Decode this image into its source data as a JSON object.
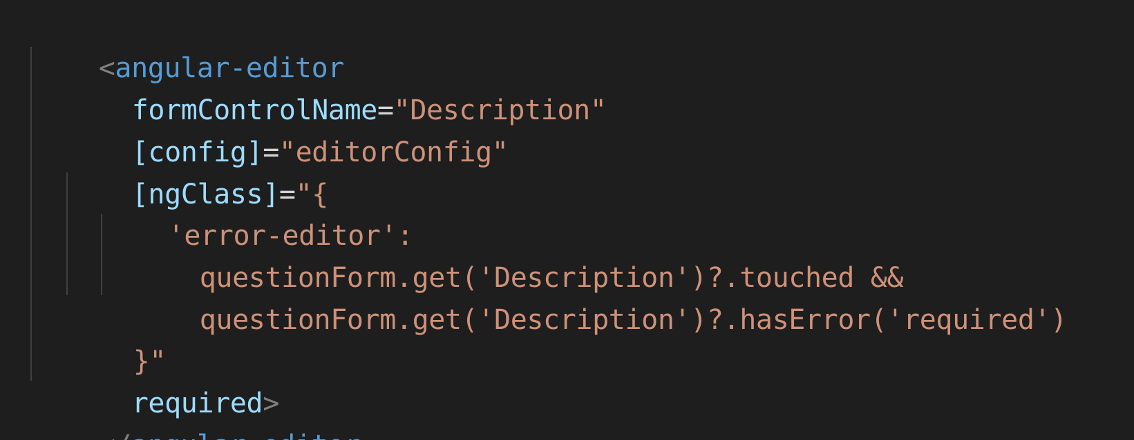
{
  "code": {
    "line1": {
      "open": "<",
      "tag": "angular-editor"
    },
    "line2": {
      "attr": "formControlName",
      "eq": "=",
      "value": "\"Description\""
    },
    "line3": {
      "attr": "[config]",
      "eq": "=",
      "value": "\"editorConfig\""
    },
    "line4": {
      "attr": "[ngClass]",
      "eq": "=",
      "value": "\"{"
    },
    "line5": {
      "key": "'error-editor':"
    },
    "line6": {
      "expr": "questionForm.get('Description')?.touched &&"
    },
    "line7": {
      "expr": "questionForm.get('Description')?.hasError('required')"
    },
    "line8": {
      "value": "}\""
    },
    "line9": {
      "attr": "required",
      "close": ">"
    },
    "line10": {
      "open": "</",
      "tag": "angular-editor"
    }
  },
  "colors": {
    "background": "#1e1e1e",
    "tag": "#569cd6",
    "attribute": "#9cdcfe",
    "string": "#ce9178",
    "punctuation": "#808080"
  }
}
